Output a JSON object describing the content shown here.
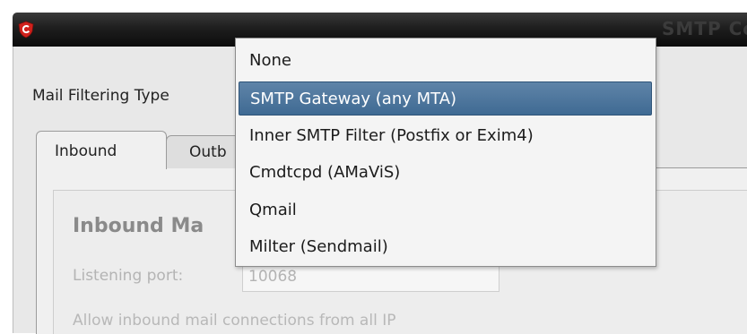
{
  "window": {
    "title": "SMTP Co",
    "app_icon": "comodo-shield-icon"
  },
  "mail_filtering": {
    "label": "Mail Filtering Type",
    "selected": "SMTP Gateway (any MTA)",
    "options": [
      "None",
      "SMTP Gateway (any MTA)",
      "Inner SMTP Filter (Postfix or Exim4)",
      "Cmdtcpd (AMaViS)",
      "Qmail",
      "Milter (Sendmail)"
    ]
  },
  "tabs": [
    {
      "label": "Inbound"
    },
    {
      "label": "Outb"
    }
  ],
  "inbound": {
    "heading": "Inbound Ma",
    "port_label": "Listening port:",
    "port_value": "10068",
    "allow_text": "Allow inbound mail connections from all IP"
  },
  "colors": {
    "selection": "#4a7199",
    "brand_red": "#d0211c"
  }
}
